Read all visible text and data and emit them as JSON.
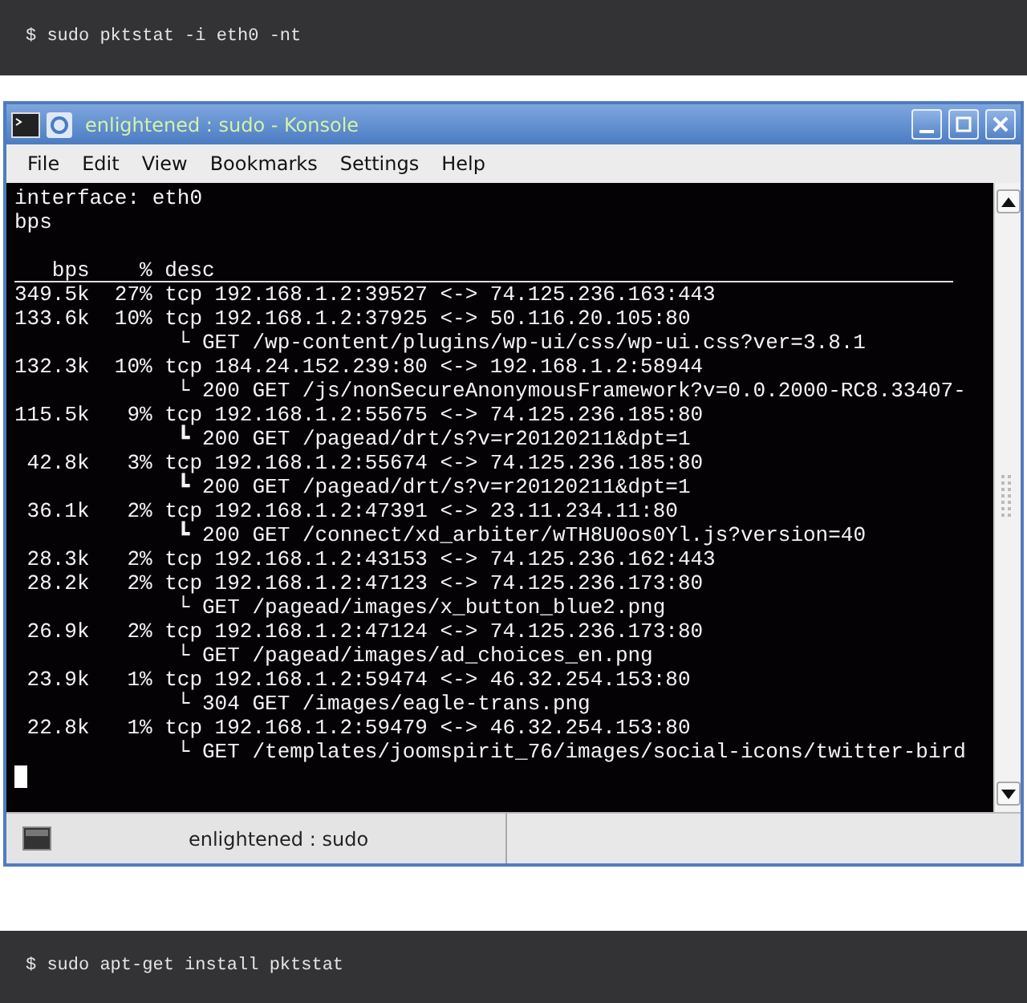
{
  "top_code_block": {
    "command": "$ sudo pktstat -i eth0 -nt"
  },
  "window": {
    "title": "enlightened : sudo - Konsole",
    "menu": [
      "File",
      "Edit",
      "View",
      "Bookmarks",
      "Settings",
      "Help"
    ],
    "terminal": {
      "info_lines": [
        "interface: eth0",
        "bps"
      ],
      "columns": [
        "bps",
        "%",
        "desc"
      ],
      "rows": [
        {
          "bps": "349.5k",
          "percent": "27%",
          "desc": "tcp 192.168.1.2:39527 <-> 74.125.236.163:443"
        },
        {
          "bps": "133.6k",
          "percent": "10%",
          "desc": "tcp 192.168.1.2:37925 <-> 50.116.20.105:80",
          "request": "└ GET /wp-content/plugins/wp-ui/css/wp-ui.css?ver=3.8.1"
        },
        {
          "bps": "132.3k",
          "percent": "10%",
          "desc": "tcp 184.24.152.239:80 <-> 192.168.1.2:58944",
          "request": "└ 200 GET /js/nonSecureAnonymousFramework?v=0.0.2000-RC8.33407-"
        },
        {
          "bps": "115.5k",
          "percent": "9%",
          "desc": "tcp 192.168.1.2:55675 <-> 74.125.236.185:80",
          "request": "┗ 200 GET /pagead/drt/s?v=r20120211&dpt=1"
        },
        {
          "bps": "42.8k",
          "percent": "3%",
          "desc": "tcp 192.168.1.2:55674 <-> 74.125.236.185:80",
          "request": "┗ 200 GET /pagead/drt/s?v=r20120211&dpt=1"
        },
        {
          "bps": "36.1k",
          "percent": "2%",
          "desc": "tcp 192.168.1.2:47391 <-> 23.11.234.11:80",
          "request": "┗ 200 GET /connect/xd_arbiter/wTH8U0os0Yl.js?version=40"
        },
        {
          "bps": "28.3k",
          "percent": "2%",
          "desc": "tcp 192.168.1.2:43153 <-> 74.125.236.162:443"
        },
        {
          "bps": "28.2k",
          "percent": "2%",
          "desc": "tcp 192.168.1.2:47123 <-> 74.125.236.173:80",
          "request": "└ GET /pagead/images/x_button_blue2.png"
        },
        {
          "bps": "26.9k",
          "percent": "2%",
          "desc": "tcp 192.168.1.2:47124 <-> 74.125.236.173:80",
          "request": "└ GET /pagead/images/ad_choices_en.png"
        },
        {
          "bps": "23.9k",
          "percent": "1%",
          "desc": "tcp 192.168.1.2:59474 <-> 46.32.254.153:80",
          "request": "└ 304 GET /images/eagle-trans.png"
        },
        {
          "bps": "22.8k",
          "percent": "1%",
          "desc": "tcp 192.168.1.2:59479 <-> 46.32.254.153:80",
          "request": "└ GET /templates/joomspirit_76/images/social-icons/twitter-bird"
        }
      ]
    },
    "tabs": [
      {
        "label": "enlightened : sudo",
        "selected": true
      }
    ]
  },
  "bottom_code_block": {
    "command": "$ sudo apt-get install pktstat"
  }
}
